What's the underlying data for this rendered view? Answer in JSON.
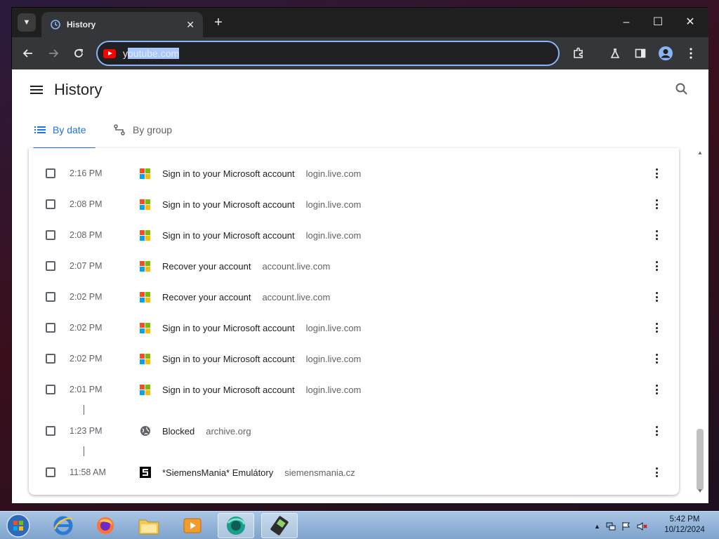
{
  "browser": {
    "tab_title": "History",
    "omnibox_value": "youtube.com",
    "omnibox_prefix": "y",
    "omnibox_selected": "outube.com"
  },
  "page": {
    "title": "History",
    "tabs": [
      {
        "label": "By date",
        "active": true
      },
      {
        "label": "By group",
        "active": false
      }
    ]
  },
  "history": {
    "items": [
      {
        "time": "2:16 PM",
        "title": "Sign in to your Microsoft account",
        "domain": "login.live.com",
        "icon": "microsoft-icon"
      },
      {
        "time": "2:08 PM",
        "title": "Sign in to your Microsoft account",
        "domain": "login.live.com",
        "icon": "microsoft-icon"
      },
      {
        "time": "2:08 PM",
        "title": "Sign in to your Microsoft account",
        "domain": "login.live.com",
        "icon": "microsoft-icon"
      },
      {
        "time": "2:07 PM",
        "title": "Recover your account",
        "domain": "account.live.com",
        "icon": "microsoft-icon"
      },
      {
        "time": "2:02 PM",
        "title": "Recover your account",
        "domain": "account.live.com",
        "icon": "microsoft-icon"
      },
      {
        "time": "2:02 PM",
        "title": "Sign in to your Microsoft account",
        "domain": "login.live.com",
        "icon": "microsoft-icon"
      },
      {
        "time": "2:02 PM",
        "title": "Sign in to your Microsoft account",
        "domain": "login.live.com",
        "icon": "microsoft-icon"
      },
      {
        "time": "2:01 PM",
        "title": "Sign in to your Microsoft account",
        "domain": "login.live.com",
        "icon": "microsoft-icon"
      },
      {
        "time": "1:23 PM",
        "title": "Blocked",
        "domain": "archive.org",
        "icon": "globe-icon"
      },
      {
        "time": "11:58 AM",
        "title": "*SiemensMania* Emulátory",
        "domain": "siemensmania.cz",
        "icon": "siemensmania-icon"
      }
    ]
  },
  "taskbar": {
    "clock_time": "5:42 PM",
    "clock_date": "10/12/2024"
  },
  "colors": {
    "accent": "#1a73e8",
    "ms_red": "#f25022",
    "ms_green": "#7fba00",
    "ms_blue": "#00a4ef",
    "ms_yellow": "#ffb900"
  }
}
